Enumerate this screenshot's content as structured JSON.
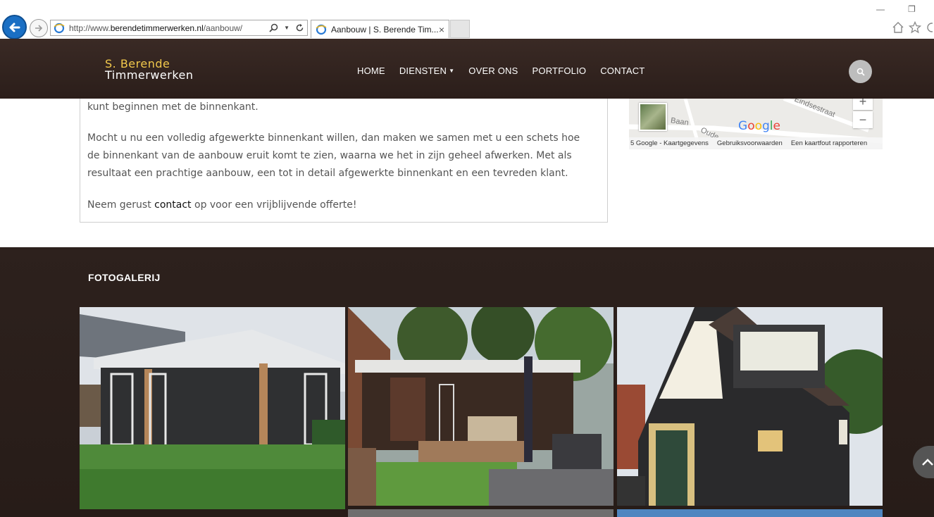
{
  "browser": {
    "url_prefix": "http://www.",
    "url_domain": "berendetimmerwerken.nl",
    "url_path": "/aanbouw/",
    "tab_title": "Aanbouw | S. Berende Tim...",
    "tab_close": "×",
    "minimize": "—",
    "restore": "❐"
  },
  "header": {
    "logo_line1": "S. Berende",
    "logo_line2": "Timmerwerken",
    "nav": [
      {
        "label": "HOME"
      },
      {
        "label": "DIENSTEN"
      },
      {
        "label": "OVER ONS"
      },
      {
        "label": "PORTFOLIO"
      },
      {
        "label": "CONTACT"
      }
    ]
  },
  "content": {
    "p1": "kunt beginnen met de binnenkant.",
    "p2": "Mocht u nu een volledig afgewerkte binnenkant willen, dan maken we samen met u een schets hoe de binnenkant van de aanbouw eruit komt te zien, waarna we het in zijn geheel afwerken. Met als resultaat een prachtige aanbouw, een tot in detail afgewerkte binnenkant en een tevreden klant.",
    "p3_before": "Neem gerust ",
    "p3_link": "contact",
    "p3_after": " op voor een vrijblijvende offerte!"
  },
  "map": {
    "street1": "Eindsestraat",
    "street2": "Baan",
    "street3": "Oude",
    "zoom_in": "+",
    "zoom_out": "−",
    "footer_data": "5 Google - Kaartgegevens",
    "footer_terms": "Gebruiksvoorwaarden",
    "footer_report": "Een kaartfout rapporteren"
  },
  "gallery": {
    "title": "FOTOGALERIJ"
  },
  "colors": {
    "header_bg": "#2e201c",
    "logo_accent": "#f2c94c",
    "gallery_bg": "#2a1e1a"
  }
}
